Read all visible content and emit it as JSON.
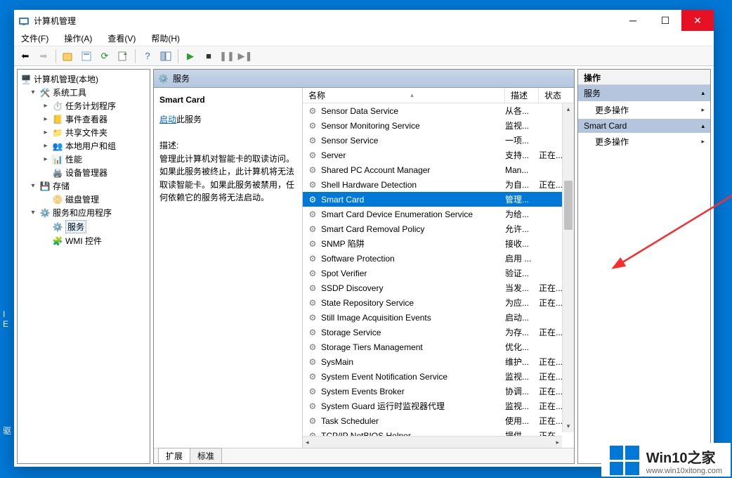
{
  "window": {
    "title": "计算机管理"
  },
  "menubar": [
    "文件(F)",
    "操作(A)",
    "查看(V)",
    "帮助(H)"
  ],
  "tree": {
    "root": "计算机管理(本地)",
    "g1": "系统工具",
    "g1_items": [
      "任务计划程序",
      "事件查看器",
      "共享文件夹",
      "本地用户和组",
      "性能",
      "设备管理器"
    ],
    "g2": "存储",
    "g2_items": [
      "磁盘管理"
    ],
    "g3": "服务和应用程序",
    "g3_items": [
      "服务",
      "WMI 控件"
    ]
  },
  "services_header": "服务",
  "detail": {
    "title": "Smart Card",
    "start_link_prefix": "启动",
    "start_link_suffix": "此服务",
    "desc_label": "描述:",
    "desc_text": "管理此计算机对智能卡的取读访问。如果此服务被终止，此计算机将无法取读智能卡。如果此服务被禁用，任何依赖它的服务将无法启动。"
  },
  "columns": {
    "name": "名称",
    "desc": "描述",
    "status": "状态"
  },
  "rows": [
    {
      "n": "Sensor Data Service",
      "d": "从各...",
      "s": ""
    },
    {
      "n": "Sensor Monitoring Service",
      "d": "监视...",
      "s": ""
    },
    {
      "n": "Sensor Service",
      "d": "一项...",
      "s": ""
    },
    {
      "n": "Server",
      "d": "支持...",
      "s": "正在..."
    },
    {
      "n": "Shared PC Account Manager",
      "d": "Man...",
      "s": ""
    },
    {
      "n": "Shell Hardware Detection",
      "d": "为自...",
      "s": "正在..."
    },
    {
      "n": "Smart Card",
      "d": "管理...",
      "s": "",
      "sel": true
    },
    {
      "n": "Smart Card Device Enumeration Service",
      "d": "为给...",
      "s": ""
    },
    {
      "n": "Smart Card Removal Policy",
      "d": "允许...",
      "s": ""
    },
    {
      "n": "SNMP 陷阱",
      "d": "接收...",
      "s": ""
    },
    {
      "n": "Software Protection",
      "d": "启用 ...",
      "s": ""
    },
    {
      "n": "Spot Verifier",
      "d": "验证...",
      "s": ""
    },
    {
      "n": "SSDP Discovery",
      "d": "当发...",
      "s": "正在..."
    },
    {
      "n": "State Repository Service",
      "d": "为应...",
      "s": "正在..."
    },
    {
      "n": "Still Image Acquisition Events",
      "d": "启动...",
      "s": ""
    },
    {
      "n": "Storage Service",
      "d": "为存...",
      "s": "正在..."
    },
    {
      "n": "Storage Tiers Management",
      "d": "优化...",
      "s": ""
    },
    {
      "n": "SysMain",
      "d": "维护...",
      "s": "正在..."
    },
    {
      "n": "System Event Notification Service",
      "d": "监视...",
      "s": "正在..."
    },
    {
      "n": "System Events Broker",
      "d": "协调...",
      "s": "正在..."
    },
    {
      "n": "System Guard 运行时监视器代理",
      "d": "监视...",
      "s": "正在..."
    },
    {
      "n": "Task Scheduler",
      "d": "使用...",
      "s": "正在..."
    },
    {
      "n": "TCP/IP NetBIOS Helper",
      "d": "提供...",
      "s": "正在..."
    }
  ],
  "tabs": {
    "extended": "扩展",
    "standard": "标准"
  },
  "actions": {
    "panel_title": "操作",
    "section1": "服务",
    "item1": "更多操作",
    "section2": "Smart Card",
    "item2": "更多操作"
  },
  "watermark": {
    "brand": "Win10之家",
    "url": "www.win10xitong.com"
  },
  "bgtext": {
    "i": "I",
    "e": "E",
    "qu": "驱"
  }
}
